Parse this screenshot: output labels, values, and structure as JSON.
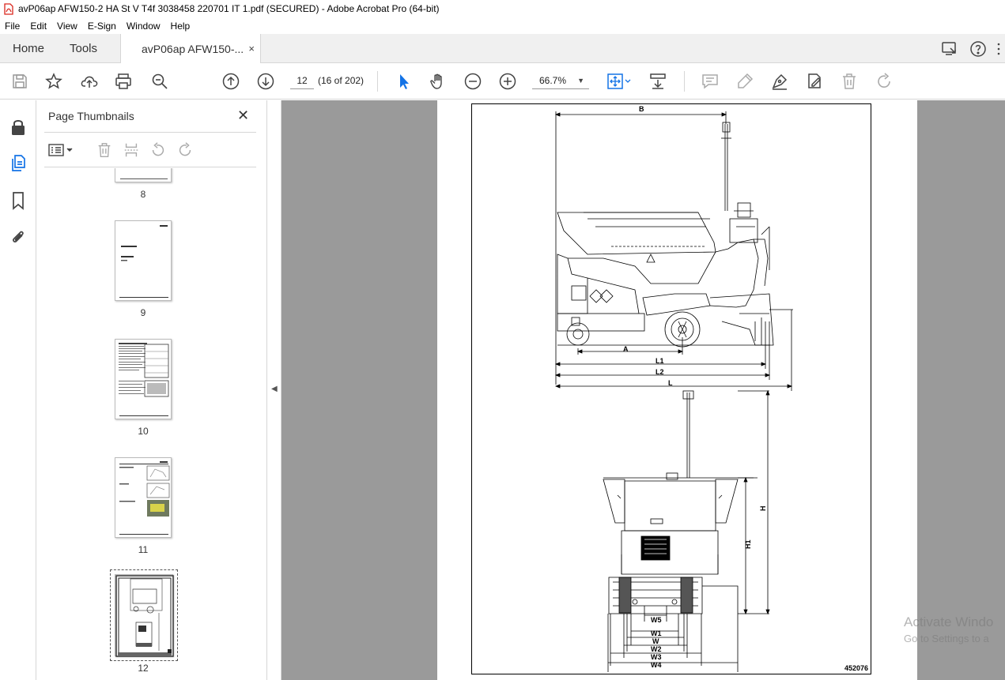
{
  "window": {
    "title": "avP06ap AFW150-2 HA St V T4f 3038458 220701 IT 1.pdf (SECURED) - Adobe Acrobat Pro (64-bit)"
  },
  "menu": [
    "File",
    "Edit",
    "View",
    "E-Sign",
    "Window",
    "Help"
  ],
  "tabs": {
    "home": "Home",
    "tools": "Tools",
    "document": "avP06ap AFW150-...",
    "close": "×"
  },
  "toolbar": {
    "page_number": "12",
    "page_count": "(16 of 202)",
    "zoom": "66.7%",
    "zoom_caret": "▼"
  },
  "panel": {
    "title": "Page Thumbnails",
    "close": "✕",
    "thumbnails": [
      {
        "label": "8"
      },
      {
        "label": "9"
      },
      {
        "label": "10"
      },
      {
        "label": "11"
      },
      {
        "label": "12",
        "selected": true
      }
    ]
  },
  "drawing": {
    "labels": [
      "B",
      "A",
      "L1",
      "L2",
      "L",
      "H",
      "H1",
      "W5",
      "W1",
      "W",
      "W2",
      "W3",
      "W4"
    ],
    "doc_id": "452076"
  },
  "watermark": {
    "line1": "Activate Windo",
    "line2": "Go to Settings to a"
  },
  "icons": {
    "rail": [
      "lock-icon",
      "pages-icon",
      "bookmark-icon",
      "attachment-icon"
    ],
    "toolbar": [
      "save-icon",
      "star-icon",
      "upload-icon",
      "print-icon",
      "zoom-search-icon",
      "prev-page-icon",
      "next-page-icon",
      "select-cursor-icon",
      "hand-icon",
      "zoom-out-icon",
      "zoom-in-icon",
      "fit-page-icon",
      "scroll-mode-icon",
      "comment-icon",
      "highlight-icon",
      "sign-icon",
      "edit-pdf-icon",
      "delete-icon",
      "redo-icon"
    ]
  },
  "colors": {
    "accent": "#1473e6",
    "viewer_bg": "#9a9a9a",
    "pdf_icon": "#d9251c"
  }
}
